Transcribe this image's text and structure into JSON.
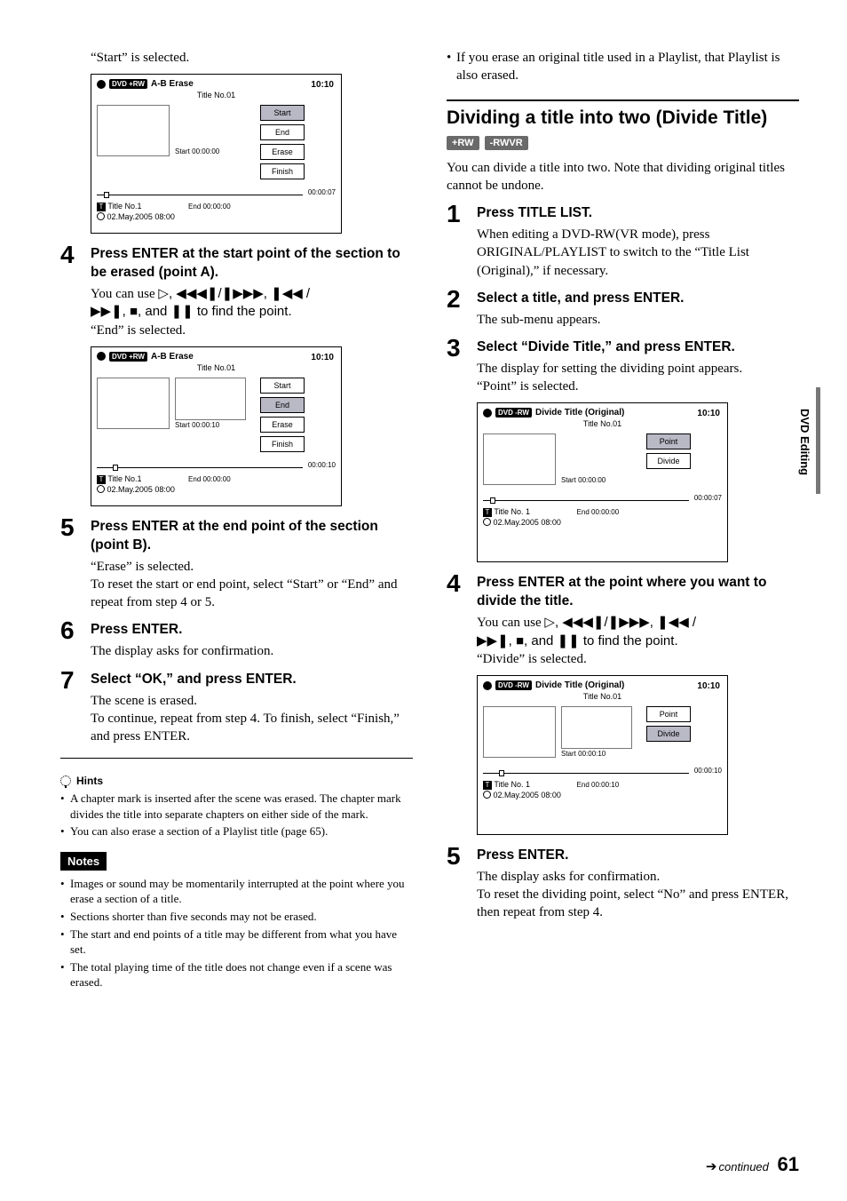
{
  "sideTab": "DVD Editing",
  "footer": {
    "continued": "continued",
    "pageNum": "61"
  },
  "left": {
    "pre": "“Start” is selected.",
    "step4": {
      "head": "Press ENTER at the start point of the section to be erased (point A).",
      "p1a": "You can use ",
      "p1icons": "▷,  ◀◀◀❚/❚▶▶▶,  ❚◀◀ /",
      "p1b": "▶▶❚,  ■, and ❚❚ to find the point.",
      "p2": "“End” is selected."
    },
    "step5": {
      "head": "Press ENTER at the end point of the section (point B).",
      "p1": "“Erase” is selected.",
      "p2": "To reset the start or end point, select “Start” or “End” and repeat from step 4 or 5."
    },
    "step6": {
      "head": "Press ENTER.",
      "p1": "The display asks for confirmation."
    },
    "step7": {
      "head": "Select “OK,” and press ENTER.",
      "p1": "The scene is erased.",
      "p2": "To continue, repeat from step 4. To finish, select “Finish,” and press ENTER."
    },
    "hintsHead": "Hints",
    "hints": [
      "A chapter mark is inserted after the scene was erased. The chapter mark divides the title into separate chapters on either side of the mark.",
      "You can also erase a section of a Playlist title (page 65)."
    ],
    "notesHead": "Notes",
    "notes": [
      "Images or sound may be momentarily interrupted at the point where you erase a section of a title.",
      "Sections shorter than five seconds may not be erased.",
      "The start and end points of a title may be different from what you have set.",
      "The total playing time of the title does not change even if a scene was erased."
    ]
  },
  "right": {
    "topNote": "If you erase an original title used in a Playlist, that Playlist is also erased.",
    "heading": "Dividing a title into two (Divide Title)",
    "tags": [
      "+RW",
      "-RWVR"
    ],
    "intro": "You can divide a title into two. Note that dividing original titles cannot be undone.",
    "step1": {
      "head": "Press TITLE LIST.",
      "p1": "When editing a DVD-RW(VR mode), press ORIGINAL/PLAYLIST to switch to the “Title List (Original),” if necessary."
    },
    "step2": {
      "head": "Select a title, and press ENTER.",
      "p1": "The sub-menu appears."
    },
    "step3": {
      "head": "Select “Divide Title,” and press ENTER.",
      "p1": "The display for setting the dividing point appears.",
      "p2": "“Point” is selected."
    },
    "step4": {
      "head": "Press ENTER at the point where you want to divide the title.",
      "p1a": "You can use ",
      "p1icons": "▷,  ◀◀◀❚/❚▶▶▶,  ❚◀◀ /",
      "p1b": "▶▶❚,  ■, and ❚❚ to find the point.",
      "p2": "“Divide” is selected."
    },
    "step5": {
      "head": "Press ENTER.",
      "p1": "The display asks for confirmation.",
      "p2": "To reset the dividing point, select “No” and press ENTER, then repeat from step 4."
    }
  },
  "osd_ab1": {
    "tag": "DVD +RW",
    "title": "A-B Erase",
    "clock": "10:10",
    "titleNo": "Title No.01",
    "start": "Start 00:00:00",
    "end": "End   00:00:00",
    "barTime": "00:00:07",
    "btns": {
      "start": "Start",
      "end": "End",
      "erase": "Erase",
      "finish": "Finish"
    },
    "footTitle": "Title No.1",
    "footDate": "02.May.2005   08:00",
    "selected": "start"
  },
  "osd_ab2": {
    "tag": "DVD +RW",
    "title": "A-B Erase",
    "clock": "10:10",
    "titleNo": "Title No.01",
    "start": "Start 00:00:10",
    "end": "End   00:00:00",
    "barTime": "00:00:10",
    "btns": {
      "start": "Start",
      "end": "End",
      "erase": "Erase",
      "finish": "Finish"
    },
    "footTitle": "Title No.1",
    "footDate": "02.May.2005   08:00",
    "selected": "end"
  },
  "osd_div1": {
    "tag": "DVD -RW",
    "title": "Divide Title (Original)",
    "clock": "10:10",
    "titleNo": "Title No.01",
    "start": "Start 00:00:00",
    "end": "End   00:00:00",
    "barTime": "00:00:07",
    "btns": {
      "point": "Point",
      "divide": "Divide"
    },
    "footTitle": "Title No. 1",
    "footDate": "02.May.2005   08:00",
    "selected": "point"
  },
  "osd_div2": {
    "tag": "DVD -RW",
    "title": "Divide Title (Original)",
    "clock": "10:10",
    "titleNo": "Title No.01",
    "start": "Start 00:00:10",
    "end": "End   00:00:10",
    "barTime": "00:00:10",
    "btns": {
      "point": "Point",
      "divide": "Divide"
    },
    "footTitle": "Title No. 1",
    "footDate": "02.May.2005   08:00",
    "selected": "divide"
  }
}
